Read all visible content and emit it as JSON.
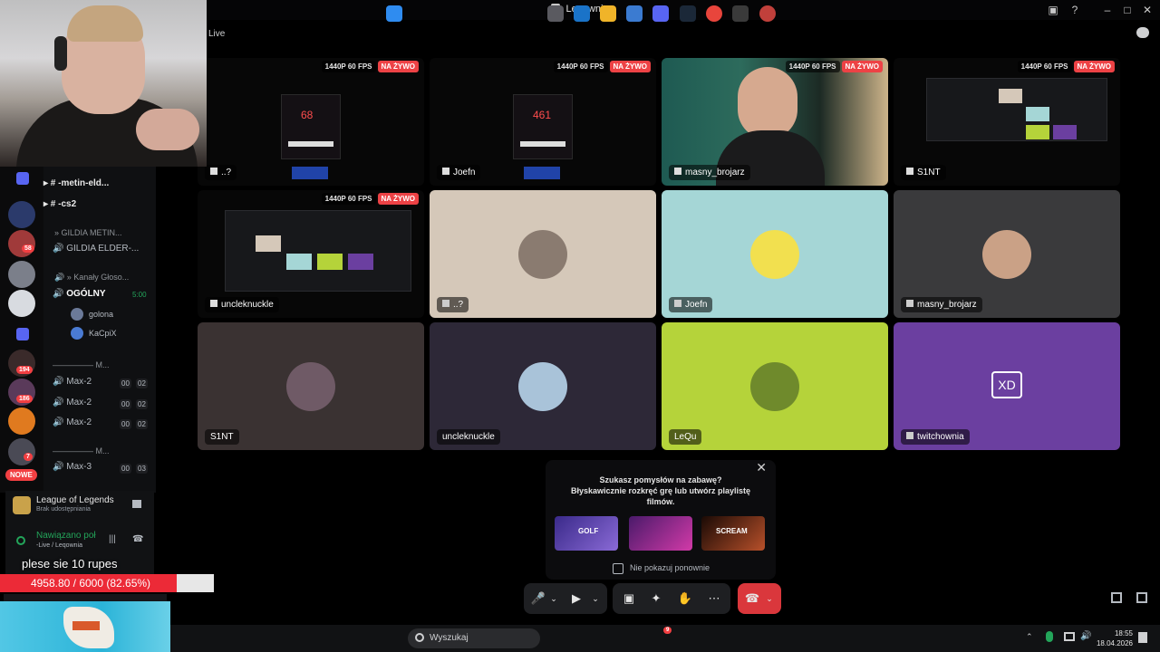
{
  "window": {
    "title": "Leqownia"
  },
  "header": {
    "live_label": "Live"
  },
  "stream_badge": {
    "quality": "1440P 60 FPS",
    "live": "NA ŻYWO"
  },
  "tiles": [
    {
      "name": "..?"
    },
    {
      "name": "Joefn"
    },
    {
      "name": "masny_brojarz"
    },
    {
      "name": "S1NT"
    },
    {
      "name": "uncleknuckle"
    },
    {
      "name": "..?"
    },
    {
      "name": "Joefn"
    },
    {
      "name": "masny_brojarz"
    },
    {
      "name": "S1NT"
    },
    {
      "name": "uncleknuckle"
    },
    {
      "name": "LeQu"
    },
    {
      "name": "twitchownia",
      "avatar_text": "XD"
    }
  ],
  "screen_counters": {
    "left": "68",
    "middle": "461"
  },
  "colors": {
    "tile_tan": "#d5c8b9",
    "tile_cyan": "#a5d6d6",
    "tile_gray": "#3a3a3c",
    "tile_purple": "#6b3fa0",
    "tile_lime": "#b5d33a",
    "tile_dark_purple": "#2d2837",
    "tile_brown": "#3a3232",
    "live_red": "#ed4245",
    "hangup_red": "#da373c"
  },
  "sidebar": {
    "channels": [
      {
        "label": "-metin-eld..."
      },
      {
        "label": "-cs2"
      }
    ],
    "cat_gildia": "GILDIA METIN...",
    "gildia_channel": "GILDIA ELDER-...",
    "cat_kanaly": "Kanały Głoso...",
    "ogolny": "OGÓLNY",
    "ogolny_time": "5:00",
    "members": [
      "golona",
      "KaCpiX"
    ],
    "div1": "M...",
    "max2_rows": [
      "Max-2",
      "Max-2",
      "Max-2"
    ],
    "max2_counts": [
      "00",
      "02"
    ],
    "div2": "M...",
    "max3": "Max-3",
    "max3_counts": [
      "00",
      "03"
    ],
    "badges": [
      "58",
      "194",
      "186",
      "7"
    ],
    "nowe": "NOWE"
  },
  "activity": {
    "game": "League of Legends",
    "sub": "Brak udostępniania"
  },
  "voice": {
    "status": "Nawiązano poł",
    "channel": "-Live / Leqownia"
  },
  "overlay": {
    "chat_line": "plese sie 10 rupes",
    "goal_text": "4958.80 / 6000 (82.65%)",
    "goal_progress": 0.8265
  },
  "popup": {
    "line1": "Szukasz pomysłów na zabawę?",
    "line2": "Błyskawicznie rozkręć grę lub utwórz playlistę",
    "line3": "filmów.",
    "checkbox_label": "Nie pokazuj ponownie",
    "thumb_labels": [
      "GOLF",
      "SCREAM"
    ]
  },
  "taskbar": {
    "search_placeholder": "Wyszukaj",
    "time": "18:55",
    "date": "18.04.2026",
    "discord_badge": "9"
  }
}
